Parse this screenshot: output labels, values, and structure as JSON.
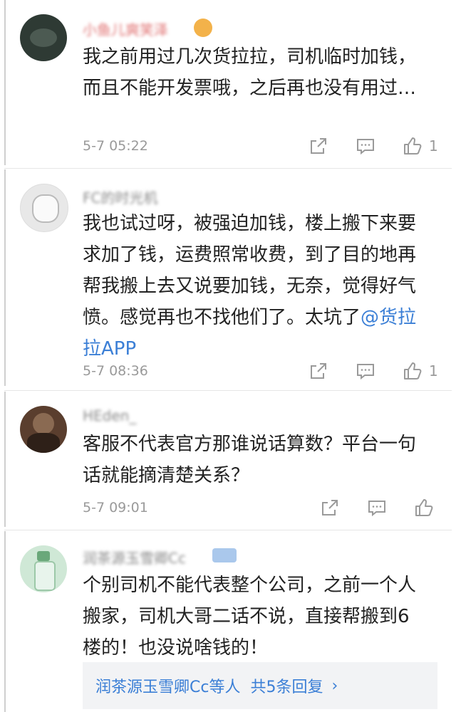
{
  "comments": [
    {
      "username": "小鱼儿爽笑泽",
      "text": "我之前用过几次货拉拉，司机临时加钱，而且不能开发票哦，之后再也没有用过…",
      "time": "5-7 05:22",
      "likes": "1",
      "avatar_color": "#2e3a34",
      "name_color": "#e07070"
    },
    {
      "username": "FC的时光机",
      "text_before": "我也试过呀，被强迫加钱，楼上搬下来要求加了钱，运费照常收费，到了目的地再帮我搬上去又说要加钱，无奈，觉得好气愤。感觉再也不找他们了。太坑了",
      "mention": "@货拉拉APP",
      "time": "5-7 08:36",
      "likes": "1",
      "avatar_color": "#e8e8e8",
      "name_color": "#888888"
    },
    {
      "username": "HEden_",
      "text": "客服不代表官方那谁说话算数？平台一句话就能摘清楚关系？",
      "time": "5-7 09:01",
      "likes": "",
      "avatar_color": "#5a3e2e",
      "name_color": "#888888"
    },
    {
      "username": "润茶源玉雪卿Cc",
      "text": "个别司机不能代表整个公司，之前一个人搬家，司机大哥二话不说，直接帮搬到6楼的！也没说啥钱的！",
      "avatar_color": "#cfe8d6",
      "name_color": "#888888"
    }
  ],
  "replies": {
    "summary": "润茶源玉雪卿Cc等人",
    "count_label": "共5条回复",
    "arrow": "›"
  },
  "icons": {
    "share": "share-icon",
    "comment": "comment-icon",
    "like": "thumbs-up-icon"
  },
  "colors": {
    "link": "#3b7fd6",
    "muted": "#9a9a9a"
  }
}
